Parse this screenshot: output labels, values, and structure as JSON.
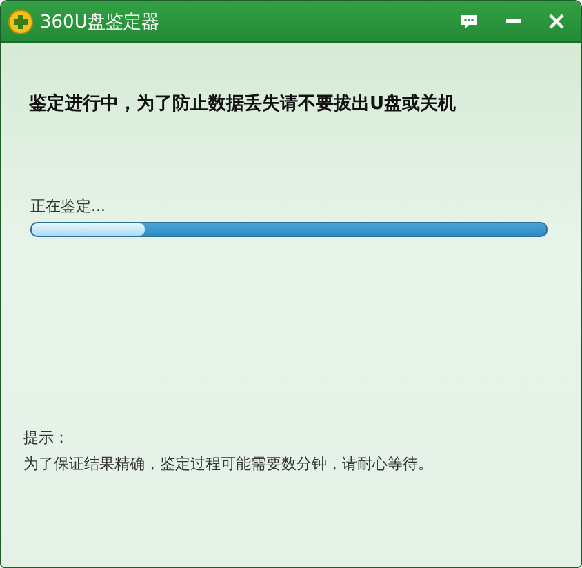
{
  "window": {
    "title": "360U盘鉴定器"
  },
  "heading": "鉴定进行中，为了防止数据丢失请不要拔出U盘或关机",
  "progress": {
    "label": "正在鉴定...",
    "level": 0.22
  },
  "hint": {
    "label": "提示：",
    "message": "为了保证结果精确，鉴定过程可能需要数分钟，请耐心等待。"
  }
}
